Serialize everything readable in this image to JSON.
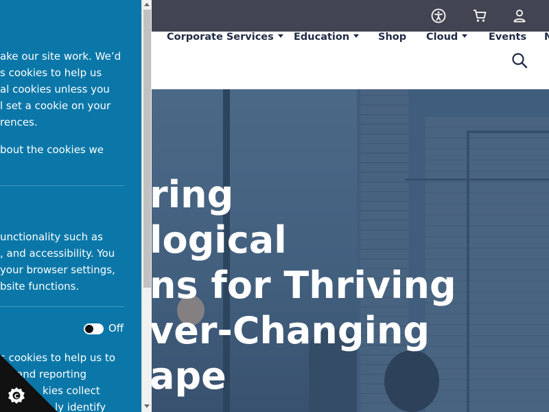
{
  "header": {
    "icons": [
      "accessibility-icon",
      "cart-icon",
      "user-icon"
    ]
  },
  "nav": {
    "items": [
      {
        "label": "Corporate Services",
        "has_dropdown": true
      },
      {
        "label": "Education",
        "has_dropdown": true
      },
      {
        "label": "Shop",
        "has_dropdown": false
      },
      {
        "label": "Cloud",
        "has_dropdown": true
      },
      {
        "label": "Events",
        "has_dropdown": false
      },
      {
        "label": "N",
        "has_dropdown": false
      }
    ],
    "search_icon": "search-icon"
  },
  "hero": {
    "lines": [
      "ring",
      "logical",
      "ns for Thriving",
      "ver-Changing",
      "ape"
    ]
  },
  "cookie_panel": {
    "intro_lines": [
      "ake our site work. We’d",
      "s cookies to help us",
      "al cookies unless you",
      "l set a cookie on your",
      "rences."
    ],
    "about_line": "bout the cookies we",
    "necessary_lines": [
      "unctionality such as",
      ", and accessibility. You",
      "your browser settings,",
      "bsite functions."
    ],
    "toggle_state": "Off",
    "analytics_lines": [
      "s cookies to help us to",
      "and reporting",
      "kies collect",
      "ly identify"
    ],
    "badge_icon": "cookie-settings-icon"
  },
  "colors": {
    "panel_bg": "#0a77a8",
    "topbar_bg": "#434452",
    "nav_text": "#1f2a44"
  }
}
